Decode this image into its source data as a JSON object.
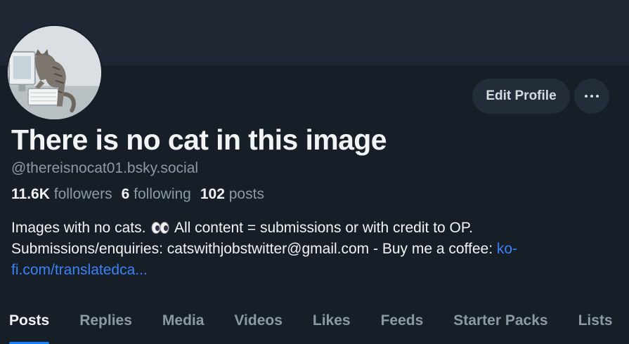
{
  "profile": {
    "display_name": "There is no cat in this image",
    "handle": "@thereisnocat01.bsky.social",
    "avatar_icon": "cat-at-computer-avatar"
  },
  "actions": {
    "edit_label": "Edit Profile",
    "more_icon": "ellipsis-icon"
  },
  "stats": {
    "followers_count": "11.6K",
    "followers_label": "followers",
    "following_count": "6",
    "following_label": "following",
    "posts_count": "102",
    "posts_label": "posts"
  },
  "bio": {
    "line1_start": "Images with no cats.",
    "line1_emoji": "eyes-emoji",
    "line1_end": "All content = submissions or with credit to OP.",
    "line2_text": "Submissions/enquiries: catswithjobstwitter@gmail.com - Buy me a coffee: ",
    "link_part1": "ko-",
    "link_part2": "fi.com/translatedca..."
  },
  "tabs": [
    "Posts",
    "Replies",
    "Media",
    "Videos",
    "Likes",
    "Feeds",
    "Starter Packs",
    "Lists"
  ],
  "colors": {
    "background": "#161e27",
    "banner": "#1e2733",
    "accent": "#1083fe",
    "link": "#3b82f6",
    "muted_text": "#8c99a6"
  }
}
